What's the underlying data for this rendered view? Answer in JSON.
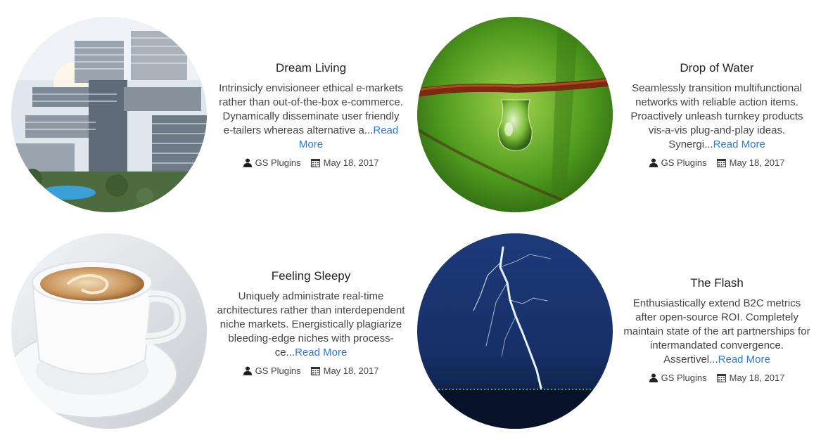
{
  "posts": [
    {
      "title": "Dream Living",
      "excerpt": "Intrinsicly envisioneer ethical e-markets rather than out-of-the-box e-commerce. Dynamically disseminate user friendly e-tailers whereas alternative a...",
      "read_more": "Read More",
      "author": "GS Plugins",
      "date": "May 18, 2017",
      "image": "buildings"
    },
    {
      "title": "Drop of Water",
      "excerpt": "Seamlessly transition multifunctional networks with reliable action items. Proactively unleash turnkey products vis-a-vis plug-and-play ideas. Synergi...",
      "read_more": "Read More",
      "author": "GS Plugins",
      "date": "May 18, 2017",
      "image": "water-drop"
    },
    {
      "title": "Feeling Sleepy",
      "excerpt": "Uniquely administrate real-time architectures rather than interdependent niche markets. Energistically plagiarize bleeding-edge niches with process-ce...",
      "read_more": "Read More",
      "author": "GS Plugins",
      "date": "May 18, 2017",
      "image": "coffee-cup"
    },
    {
      "title": "The Flash",
      "excerpt": "Enthusiastically extend B2C metrics after open-source ROI. Completely maintain state of the art partnerships for intermandated convergence. Assertivel...",
      "read_more": "Read More",
      "author": "GS Plugins",
      "date": "May 18, 2017",
      "image": "lightning"
    }
  ],
  "colors": {
    "link": "#2a7ad8",
    "text": "#444444",
    "title": "#222222"
  },
  "icons": {
    "author": "user-icon",
    "date": "calendar-icon"
  }
}
